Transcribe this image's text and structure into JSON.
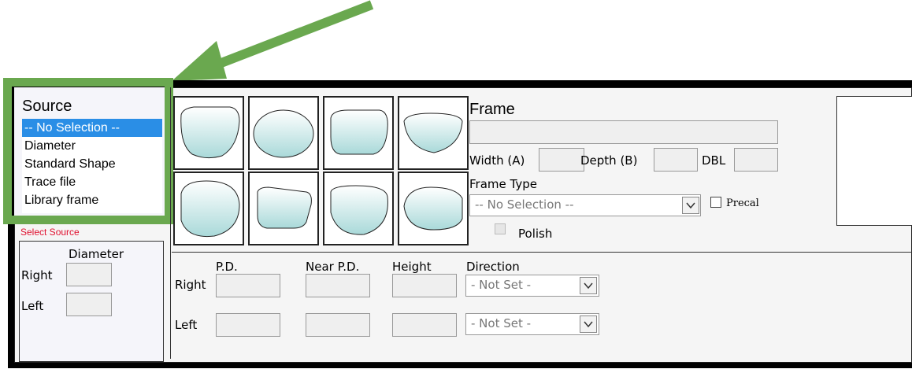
{
  "colors": {
    "highlight_green": "#6aa84f",
    "selection_blue": "#2a8ee6",
    "warning_red": "#e0102e"
  },
  "source": {
    "title": "Source",
    "items": [
      "-- No Selection --",
      "Diameter",
      "Standard Shape",
      "Trace file",
      "Library frame"
    ],
    "selected_index": 0,
    "warning": "Select Source"
  },
  "diameter": {
    "header": "Diameter",
    "right_label": "Right",
    "left_label": "Left"
  },
  "frame": {
    "title": "Frame",
    "width_label": "Width (A)",
    "depth_label": "Depth (B)",
    "dbl_label": "DBL",
    "type_label": "Frame Type",
    "type_value": "-- No Selection --",
    "precal_label": "Precal",
    "polish_label": "Polish"
  },
  "measure": {
    "headers": {
      "pd": "P.D.",
      "near_pd": "Near P.D.",
      "height": "Height",
      "direction": "Direction"
    },
    "right_label": "Right",
    "left_label": "Left",
    "right_direction": "- Not Set -",
    "left_direction": "- Not Set -"
  },
  "icons": {
    "arrow": "arrow-pointer-icon",
    "dropdown": "chevron-down-icon",
    "checkbox": "checkbox-icon"
  }
}
